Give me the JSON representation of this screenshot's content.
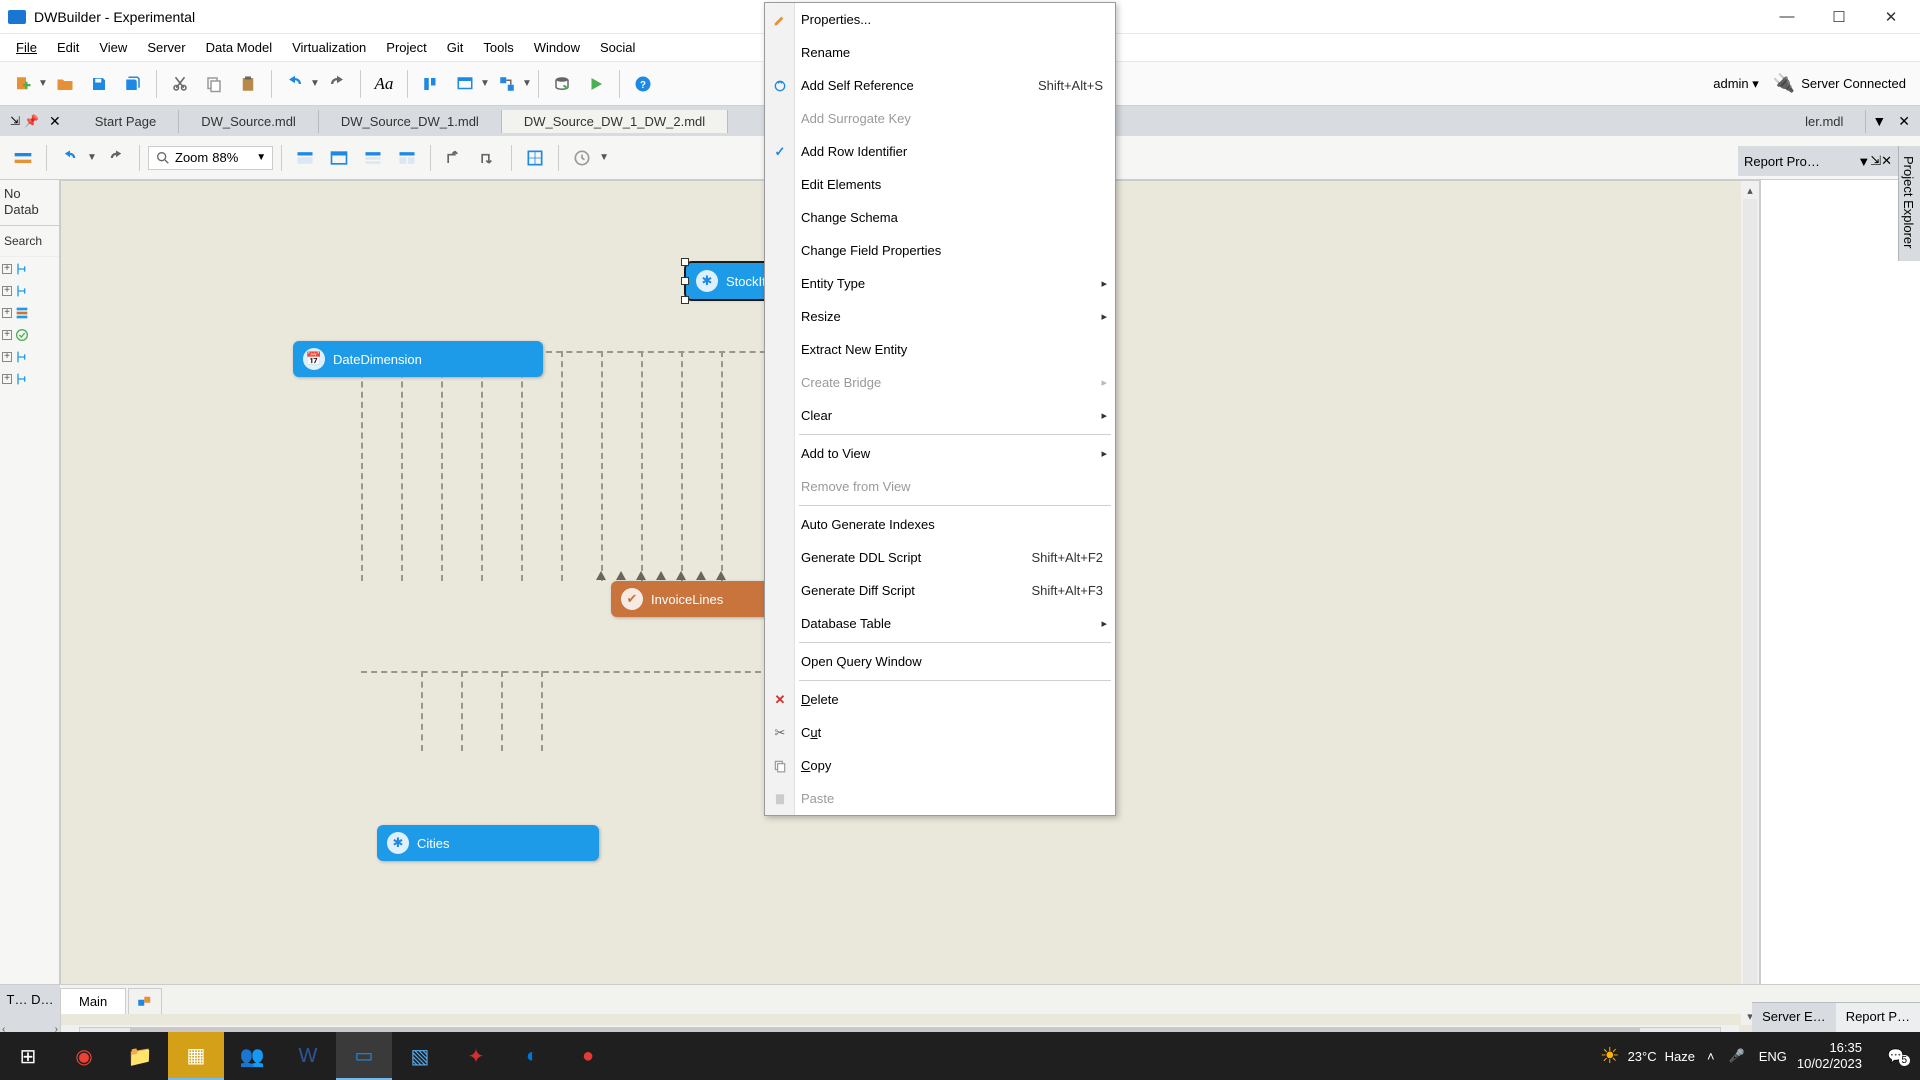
{
  "window": {
    "title": "DWBuilder - Experimental",
    "controls": {
      "min": "—",
      "max": "☐",
      "close": "✕"
    }
  },
  "menubar": [
    "File",
    "Edit",
    "View",
    "Server",
    "Data Model",
    "Virtualization",
    "Project",
    "Git",
    "Tools",
    "Window",
    "Social"
  ],
  "toolbar_right": {
    "user": "admin ▾",
    "server_status": "Server Connected"
  },
  "tabs": {
    "items": [
      "Start Page",
      "DW_Source.mdl",
      "DW_Source_DW_1.mdl",
      "DW_Source_DW_1_DW_2.mdl"
    ],
    "overflow_visible": "ler.mdl"
  },
  "right_panel": {
    "title": "Report Pro…"
  },
  "right_edge": {
    "label": "Project Explorer"
  },
  "editor_toolbar": {
    "zoom_label": "Zoom",
    "zoom_value": "88%"
  },
  "left_sidebar": {
    "nodb_line1": "No",
    "nodb_line2": "Datab",
    "search": "Search"
  },
  "entities": {
    "stockitem": "StockItem",
    "datedimension": "DateDimension",
    "invoicelines": "InvoiceLines",
    "cities": "Cities"
  },
  "context_menu": [
    {
      "label": "Properties...",
      "icon": "edit",
      "interact": true
    },
    {
      "label": "Rename",
      "interact": true
    },
    {
      "label": "Add Self Reference",
      "shortcut": "Shift+Alt+S",
      "icon": "selfref",
      "interact": true
    },
    {
      "label": "Add Surrogate Key",
      "disabled": true
    },
    {
      "label": "Add Row Identifier",
      "icon": "check",
      "interact": true
    },
    {
      "label": "Edit Elements",
      "interact": true
    },
    {
      "label": "Change Schema",
      "interact": true
    },
    {
      "label": "Change Field Properties",
      "interact": true
    },
    {
      "label": "Entity Type",
      "submenu": true,
      "interact": true
    },
    {
      "label": "Resize",
      "submenu": true,
      "interact": true
    },
    {
      "label": "Extract New Entity",
      "interact": true
    },
    {
      "label": "Create Bridge",
      "submenu": true,
      "disabled": true
    },
    {
      "label": "Clear",
      "submenu": true,
      "interact": true
    },
    {
      "sep": true
    },
    {
      "label": "Add to View",
      "submenu": true,
      "interact": true
    },
    {
      "label": "Remove from View",
      "disabled": true
    },
    {
      "sep": true
    },
    {
      "label": "Auto Generate Indexes",
      "interact": true
    },
    {
      "label": "Generate DDL Script",
      "shortcut": "Shift+Alt+F2",
      "interact": true
    },
    {
      "label": "Generate Diff Script",
      "shortcut": "Shift+Alt+F3",
      "interact": true
    },
    {
      "label": "Database Table",
      "submenu": true,
      "interact": true
    },
    {
      "sep": true
    },
    {
      "label": "Open Query Window",
      "interact": true
    },
    {
      "sep": true
    },
    {
      "label": "Delete",
      "icon": "x-red",
      "underline": "D",
      "interact": true
    },
    {
      "label": "Cut",
      "icon": "cut",
      "underline": "u",
      "interact": true
    },
    {
      "label": "Copy",
      "icon": "copy",
      "underline": "C",
      "interact": true
    },
    {
      "label": "Paste",
      "icon": "paste",
      "disabled": true
    }
  ],
  "bottom_tabs": {
    "left_nav": "‹ ›",
    "tlabel": "T… D…",
    "main": "Main"
  },
  "status_right": [
    "Server E…",
    "Report P…"
  ],
  "taskbar": {
    "weather_temp": "23°C",
    "weather_cond": "Haze",
    "lang": "ENG",
    "time": "16:35",
    "date": "10/02/2023",
    "notif_count": "5"
  }
}
